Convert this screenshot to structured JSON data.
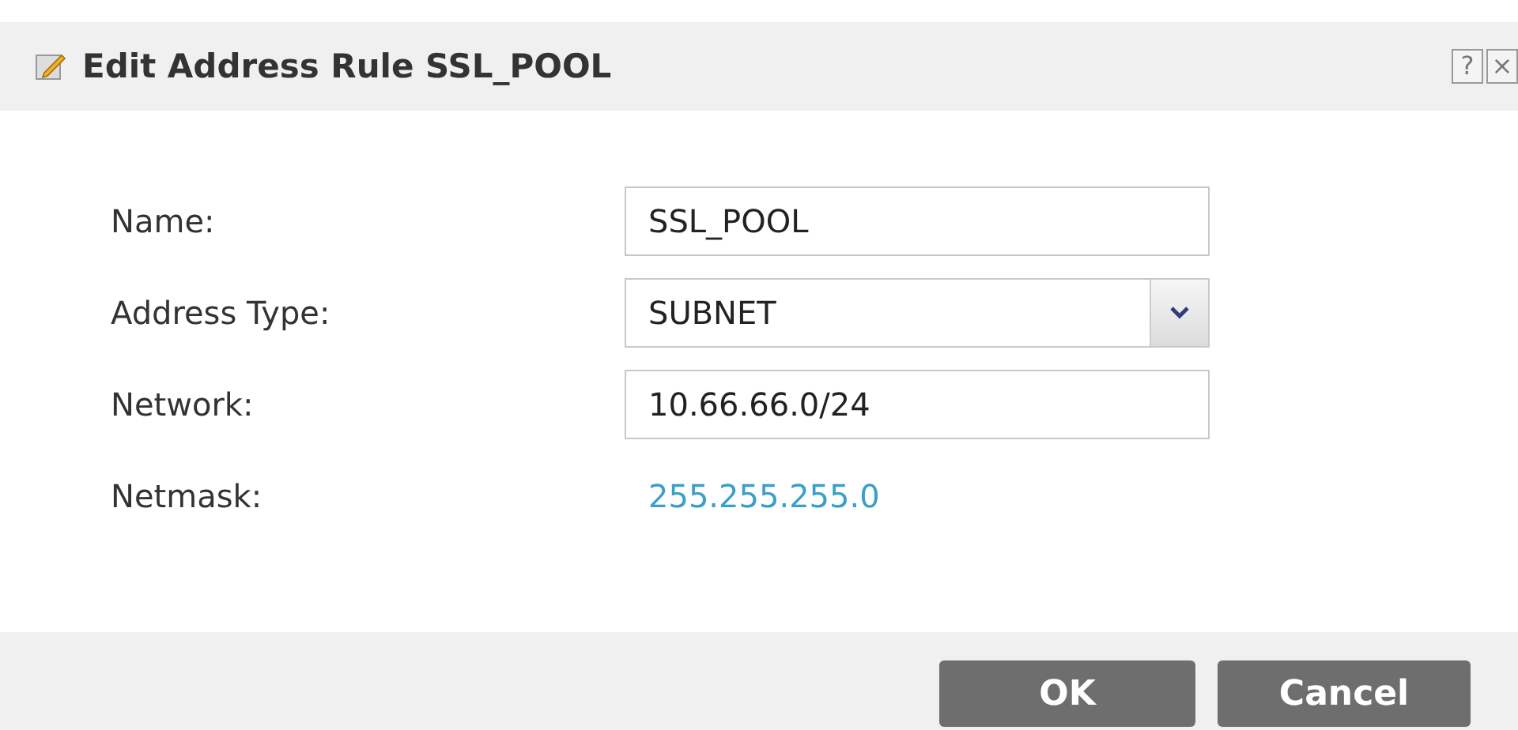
{
  "window": {
    "title": "Edit Address Rule SSL_POOL",
    "help": "?",
    "close": "×"
  },
  "fields": [
    {
      "kind": "text",
      "label": "Name:",
      "value": "SSL_POOL"
    },
    {
      "kind": "select",
      "label": "Address Type:",
      "value": "SUBNET"
    },
    {
      "kind": "text",
      "label": "Network:",
      "value": "10.66.66.0/24"
    },
    {
      "kind": "static",
      "label": "Netmask:",
      "value": "255.255.255.0"
    }
  ],
  "buttons": [
    "OK",
    "Cancel"
  ]
}
